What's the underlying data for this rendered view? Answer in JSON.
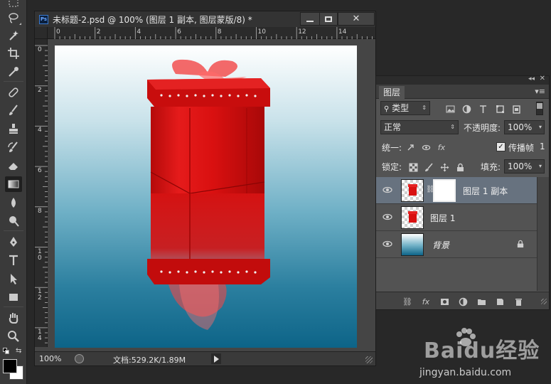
{
  "toolbar": {
    "tools": [
      "marquee-tool",
      "lasso-tool",
      "magic-wand-tool",
      "crop-tool",
      "eyedropper-tool",
      "healing-brush-tool",
      "brush-tool",
      "clone-stamp-tool",
      "history-brush-tool",
      "eraser-tool",
      "gradient-tool",
      "blur-tool",
      "dodge-tool",
      "pen-tool",
      "type-tool",
      "path-selection-tool",
      "rectangle-tool",
      "hand-tool",
      "zoom-tool"
    ],
    "active_tool": "gradient-tool",
    "foreground_color": "#000000",
    "background_color": "#ffffff"
  },
  "document": {
    "ps_badge": "Ps",
    "title": "未标题-2.psd @ 100% (图层 1 副本, 图层蒙版/8) *",
    "ruler_h": [
      "0",
      "2",
      "4",
      "6",
      "8",
      "10",
      "12",
      "14"
    ],
    "ruler_v": [
      "0",
      "2",
      "4",
      "6",
      "8",
      "1\n0",
      "1\n2",
      "1\n4"
    ],
    "zoom": "100%",
    "doc_info": "文档:529.2K/1.89M",
    "canvas_gradient": [
      "#ffffff",
      "#c9e2ea",
      "#6fb0c6",
      "#2b7f9f",
      "#0d6488"
    ]
  },
  "layers_panel": {
    "tab": "图层",
    "filter_kind": "类型",
    "blend_mode": "正常",
    "opacity_label": "不透明度:",
    "opacity_value": "100%",
    "unify_label": "统一:",
    "propagate_label": "传播帧",
    "propagate_value": "1",
    "propagate_checked": true,
    "lock_label": "锁定:",
    "fill_label": "填充:",
    "fill_value": "100%",
    "layers": [
      {
        "name": "图层 1 副本",
        "visible": true,
        "selected": true,
        "has_mask": true
      },
      {
        "name": "图层 1",
        "visible": true,
        "selected": false,
        "has_mask": false
      },
      {
        "name": "背景",
        "visible": true,
        "selected": false,
        "locked": true
      }
    ]
  },
  "watermark": {
    "brand": "Baidu经验",
    "url": "jingyan.baidu.com"
  }
}
